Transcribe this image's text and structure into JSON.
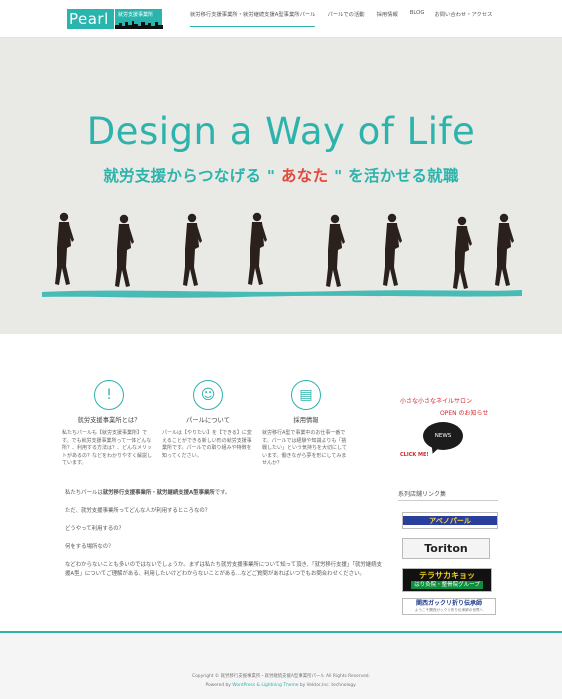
{
  "colors": {
    "accent": "#2cb3ab",
    "highlight": "#e14a3c",
    "hero_bg": "#e9e9e6"
  },
  "header": {
    "logo_text": "Pearl",
    "logo_sub": "就労支援事業所",
    "nav": [
      {
        "label": "就労移行支援事業所・就労継続支援A型事業所パール",
        "active": true
      },
      {
        "label": "パールでの活動"
      },
      {
        "label": "採用情報"
      },
      {
        "label": "BLOG"
      },
      {
        "label": "お問い合わせ・アクセス"
      }
    ]
  },
  "hero": {
    "title": "Design a Way of Life",
    "subtitle_pre": "就労支援からつなげる \"",
    "subtitle_highlight": " あなた ",
    "subtitle_post": "\" を活かせる就職"
  },
  "features": [
    {
      "icon": "exclamation-icon",
      "title": "就労支援事業所とは？",
      "text_a": "私たちパールも【就労支援事業所】です。でも就労支援事業所って一体どんな所？、利用する方法は？、どんなメリットがあるの？などをわかりやすく解説しています。"
    },
    {
      "icon": "smile-icon",
      "title": "パールについて",
      "text_a": "パールは【やりたい】を【できる】に変えることができる新しい形の就労支援事業所です。パールでの取り組みや特徴を知ってください。"
    },
    {
      "icon": "clipboard-icon",
      "title": "採用情報",
      "text_a": "就労移行A型で事業中のお仕事一番です。パールでは経験や知識よりも「挑戦したい」という気持ちを大切にしています。働きながら夢を形にしてみませんか？"
    }
  ],
  "content": {
    "intro_prefix": "私たちパールは",
    "intro_bold": "就労移行支援事業所・就労継続支援A型事業所",
    "intro_suffix": "です。",
    "q1": "ただ、就労支援事業所ってどんな人が利用するところなの？",
    "q2": "どうやって利用するの？",
    "q3": "何をする場所なの？",
    "para": "などわからないことも多いのではないでしょうか。まずは私たち就労支援事業所について知って頂き、「就労移行支援」「就労継続支援A型」についてご理解がある、利用したいけどわからないことがある…などご質問があればいつでもお問合わせください。"
  },
  "sidebar": {
    "nail_line1": "小さな小さなネイルサロン",
    "nail_line2": "OPEN のお知らせ",
    "nail_bubble": "NEWS",
    "nail_click": "CLICK ME!",
    "links_heading": "系列店舗リンク集",
    "banner1": "アベノパール",
    "banner2": "Toriton",
    "banner3_line1": "テラサカキョッ",
    "banner3_line2": "はり灸院・整骨院グループ",
    "banner4_line1": "関西ガックリ折り伝承師",
    "banner4_line2": "ようこそ関西ガックリ折り伝承師の世界へ"
  },
  "footer": {
    "copyright": "Copyright © 就労移行支援事業所・就労継続支援A型事業所パール All Rights Reserved.",
    "powered_pre": "Powered by ",
    "powered_link": "WordPress & Lightning Theme",
    "powered_post": " by Vektor,Inc. technology."
  }
}
